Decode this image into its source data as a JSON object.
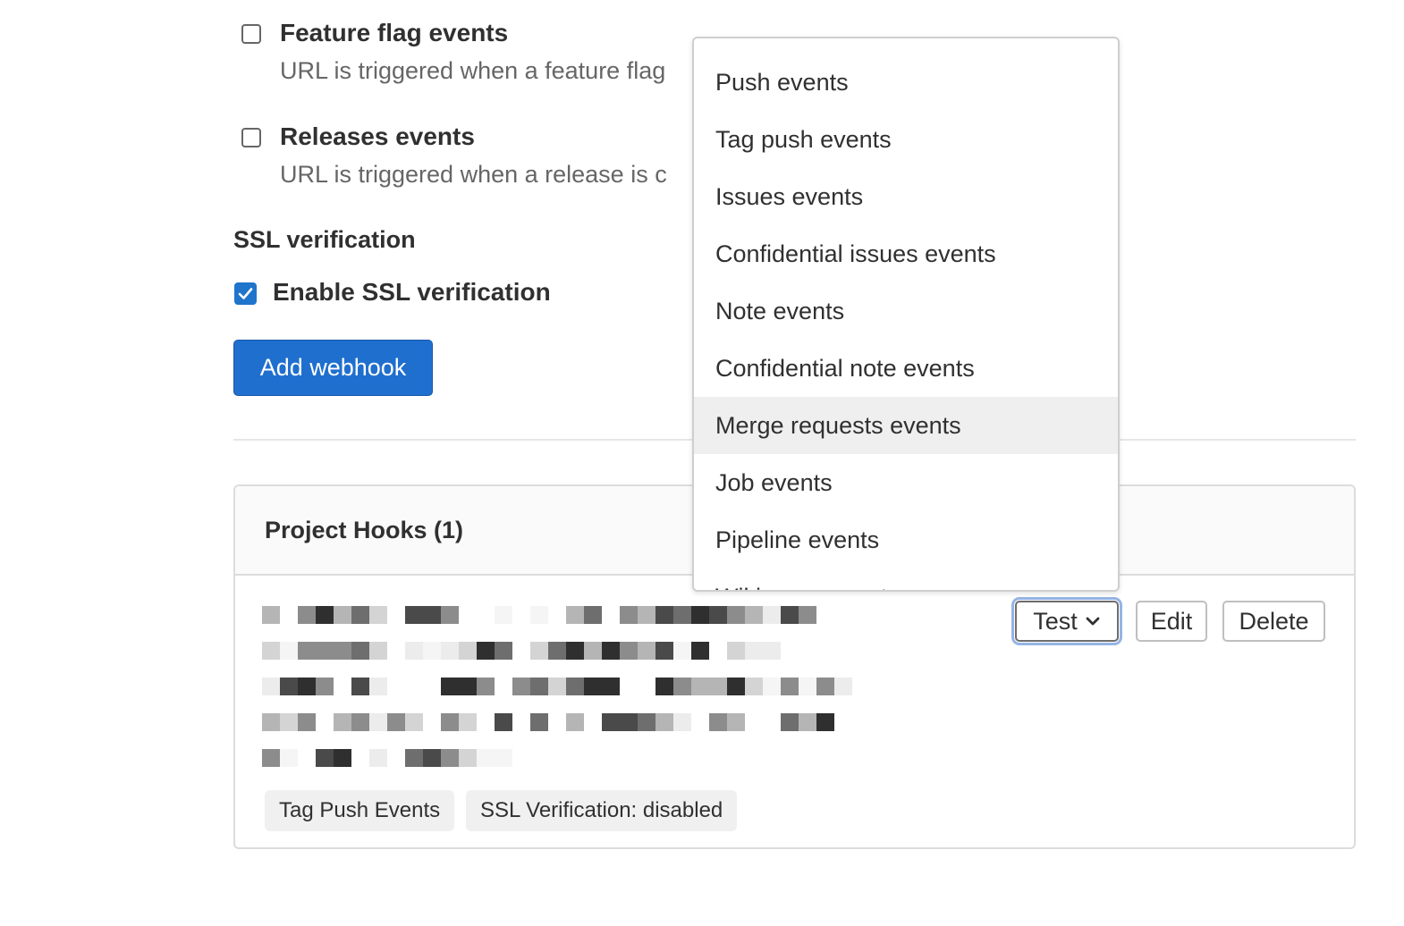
{
  "events": [
    {
      "title": "Feature flag events",
      "description": "URL is triggered when a feature flag",
      "checked": false
    },
    {
      "title": "Releases events",
      "description": "URL is triggered when a release is c",
      "checked": false
    }
  ],
  "ssl": {
    "heading": "SSL verification",
    "checkbox_label": "Enable SSL verification",
    "checked": true
  },
  "add_webhook_label": "Add webhook",
  "hooks": {
    "title": "Project Hooks (1)",
    "badges": [
      "Tag Push Events",
      "SSL Verification: disabled"
    ],
    "buttons": {
      "test": "Test",
      "edit": "Edit",
      "delete": "Delete"
    }
  },
  "test_menu": {
    "items": [
      "Push events",
      "Tag push events",
      "Issues events",
      "Confidential issues events",
      "Note events",
      "Confidential note events",
      "Merge requests events",
      "Job events",
      "Pipeline events",
      "Wiki page events"
    ],
    "highlighted": "Merge requests events"
  },
  "colors": {
    "primary": "#1f6fcf",
    "checkbox_checked": "#1f75cb",
    "focus_ring": "#95b4e4"
  }
}
